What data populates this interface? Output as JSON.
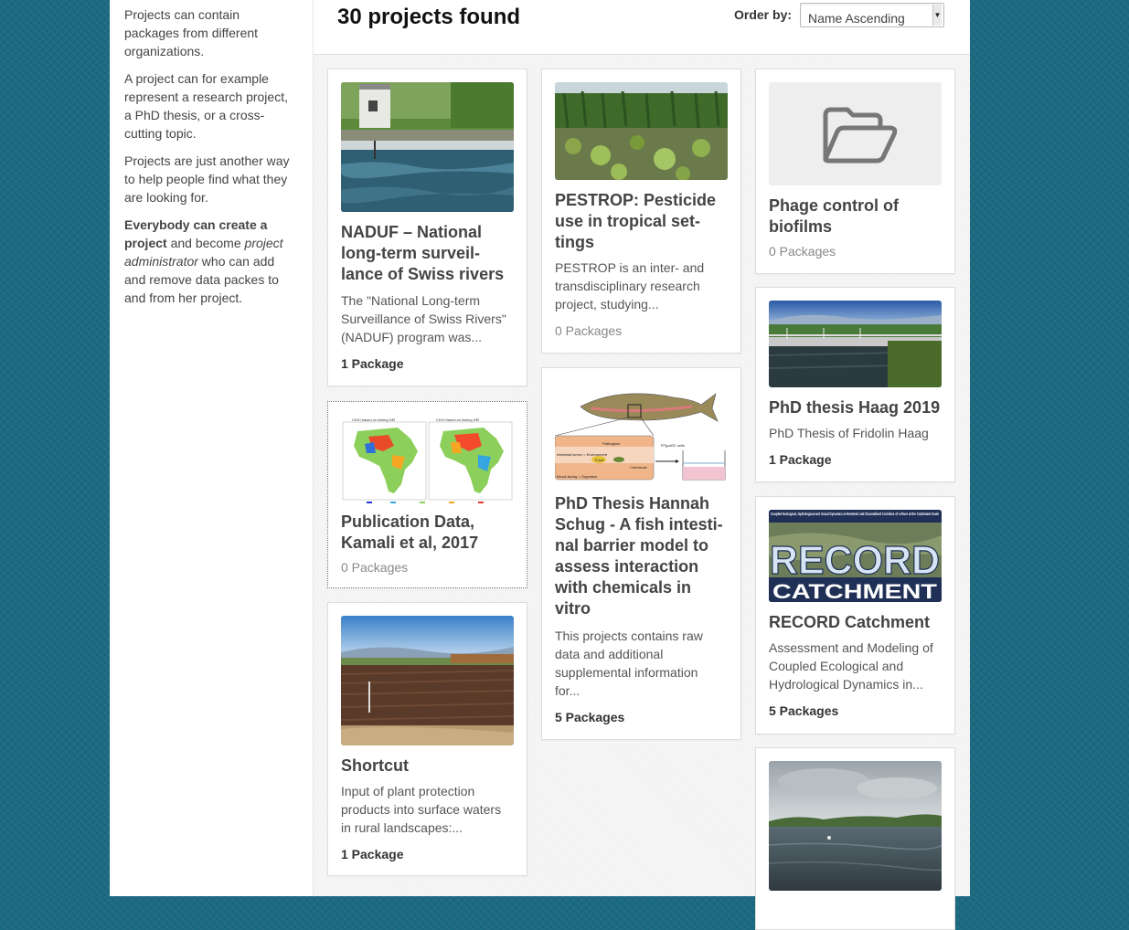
{
  "sidebar": {
    "p1": "Projects can contain packages from different organizations.",
    "p2": "A project can for example represent a research project, a PhD thesis, or a cross-cutting topic.",
    "p3": "Projects are just another way to help people find what they are looking for.",
    "p4_strong": "Everybody can create a project",
    "p4_mid": " and become ",
    "p4_em": "project administrator",
    "p4_end": " who can add and remove data packes to and from her project."
  },
  "results": {
    "title": "30 projects found"
  },
  "order": {
    "label": "Order by:",
    "value": "Name Ascending"
  },
  "projects": [
    {
      "title": "NADUF – National long-term surveil-lance of Swiss rivers",
      "description": "The \"National Long-term Surveillance of Swiss Rivers\" (NADUF) program was...",
      "packages": "1 Package"
    },
    {
      "title": "Publication Data, Kamali et al, 2017",
      "description": "",
      "packages": "0 Packages"
    },
    {
      "title": "Shortcut",
      "description": "Input of plant protection products into surface waters in rural landscapes:...",
      "packages": "1 Package"
    },
    {
      "title": "PESTROP: Pesticide use in tropical set-tings",
      "description": "PESTROP is an inter- and transdisciplinary research project, studying...",
      "packages": "0 Packages"
    },
    {
      "title": "PhD Thesis Hannah Schug - A fish intesti-nal barrier model to assess interaction with chemicals in vitro",
      "description": "This projects contains raw data and additional supplemental information for...",
      "packages": "5 Packages"
    },
    {
      "title": "Phage control of biofilms",
      "description": "",
      "packages": "0 Packages"
    },
    {
      "title": "PhD thesis Haag 2019",
      "description": "PhD Thesis of Fridolin Haag",
      "packages": "1 Package"
    },
    {
      "title": "RECORD Catchment",
      "description": "Assessment and Modeling of Coupled Ecological and Hydrological Dynamics in...",
      "packages": "5 Packages"
    }
  ],
  "images": {
    "map_small_labels": [
      "CDVI based on linking DEI",
      "CDVI based on linking DEI"
    ],
    "fish_labels": [
      "Intestinal lumen = Environment",
      "Pathogens",
      "Food",
      "Chemicals",
      "Blood-facing = Organism",
      "RTgutGC cells"
    ],
    "record_banner_top": "Coupled Ecological, Hydrological and Social Dynamics in Restored and Channelized Corridors of a River at the Catchment Scale",
    "record_big1": "RECORD",
    "record_big2": "CATCHMENT"
  },
  "icons": {
    "folder": "folder-open-icon"
  }
}
